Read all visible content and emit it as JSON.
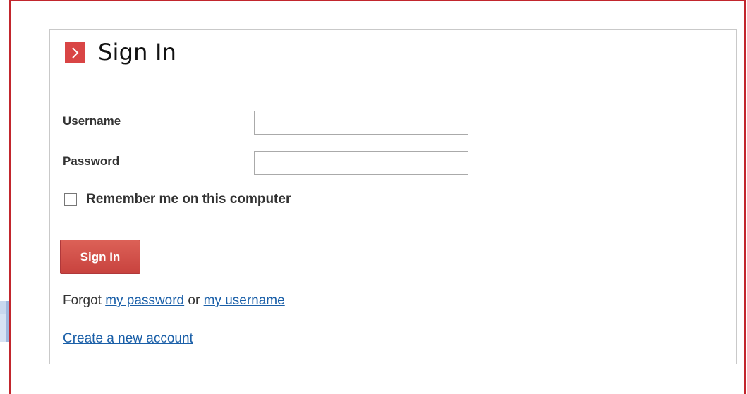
{
  "colors": {
    "accent": "#c2262d",
    "button": "#d0504a",
    "link": "#1a5fa8",
    "header_icon": "#d94545"
  },
  "panel": {
    "title": "Sign In",
    "header_icon": "chevron-right-icon"
  },
  "form": {
    "username_label": "Username",
    "username_value": "",
    "password_label": "Password",
    "password_value": "",
    "remember_label": "Remember me on this computer",
    "remember_checked": false,
    "submit_label": "Sign In"
  },
  "links": {
    "forgot_prefix": "Forgot",
    "forgot_password": "my password",
    "forgot_or": "or",
    "forgot_username": "my username",
    "create_account": "Create a new account"
  }
}
